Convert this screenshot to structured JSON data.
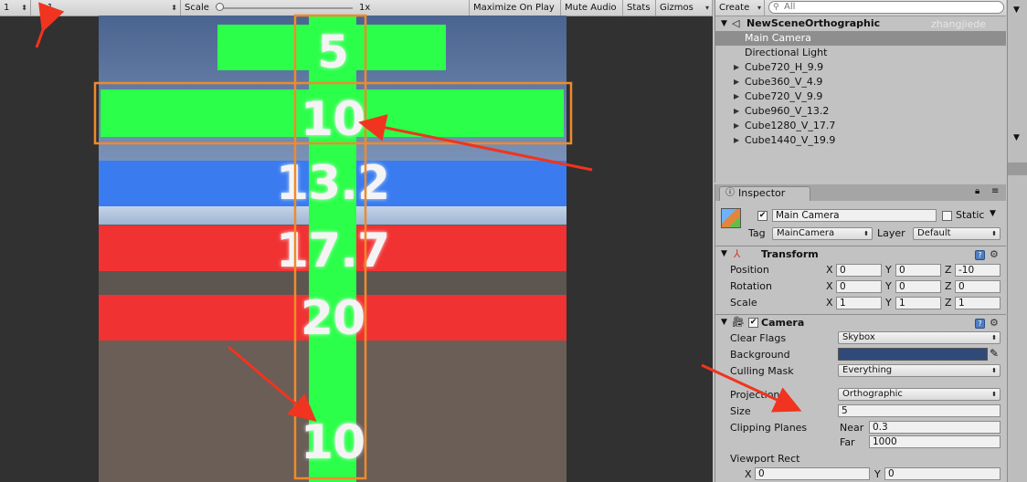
{
  "game_toolbar": {
    "display_value": "1",
    "aspect": "1:1",
    "scale_label": "Scale",
    "scale_value": "1x",
    "maximize_on_play": "Maximize On Play",
    "mute_audio": "Mute Audio",
    "stats": "Stats",
    "gizmos": "Gizmos"
  },
  "scene": {
    "labels": [
      "5",
      "10",
      "13.2",
      "17.7",
      "20",
      "10"
    ],
    "colors": {
      "green": "#2cff4a",
      "blue": "#3a7cf0",
      "red": "#f03232",
      "sky": "#4a6490",
      "ground": "#6a5e57"
    }
  },
  "hierarchy": {
    "create_label": "Create",
    "search_placeholder": "All",
    "scene_name": "NewSceneOrthographic",
    "watermark": "zhangjiede",
    "items": [
      {
        "label": "Main Camera",
        "selected": true
      },
      {
        "label": "Directional Light"
      },
      {
        "label": "Cube720_H_9.9"
      },
      {
        "label": "Cube360_V_4.9"
      },
      {
        "label": "Cube720_V_9.9"
      },
      {
        "label": "Cube960_V_13.2"
      },
      {
        "label": "Cube1280_V_17.7"
      },
      {
        "label": "Cube1440_V_19.9"
      }
    ]
  },
  "inspector": {
    "tab_label": "Inspector",
    "object_name": "Main Camera",
    "static_label": "Static",
    "tag_label": "Tag",
    "tag_value": "MainCamera",
    "layer_label": "Layer",
    "layer_value": "Default",
    "transform": {
      "title": "Transform",
      "position_label": "Position",
      "rotation_label": "Rotation",
      "scale_label": "Scale",
      "position": [
        "0",
        "0",
        "-10"
      ],
      "rotation": [
        "0",
        "0",
        "0"
      ],
      "scale": [
        "1",
        "1",
        "1"
      ]
    },
    "camera": {
      "title": "Camera",
      "clear_flags_label": "Clear Flags",
      "clear_flags": "Skybox",
      "background_label": "Background",
      "background_color": "#2f4a78",
      "culling_mask_label": "Culling Mask",
      "culling_mask": "Everything",
      "projection_label": "Projection",
      "projection": "Orthographic",
      "size_label": "Size",
      "size": "5",
      "clipping_label": "Clipping Planes",
      "near_label": "Near",
      "near": "0.3",
      "far_label": "Far",
      "far": "1000",
      "viewport_label": "Viewport Rect",
      "vx": "0",
      "vy": "0"
    },
    "axis": {
      "x": "X",
      "y": "Y",
      "z": "Z"
    }
  },
  "annotation_colors": {
    "arrow": "#f0341f",
    "box": "#f08a2a"
  }
}
